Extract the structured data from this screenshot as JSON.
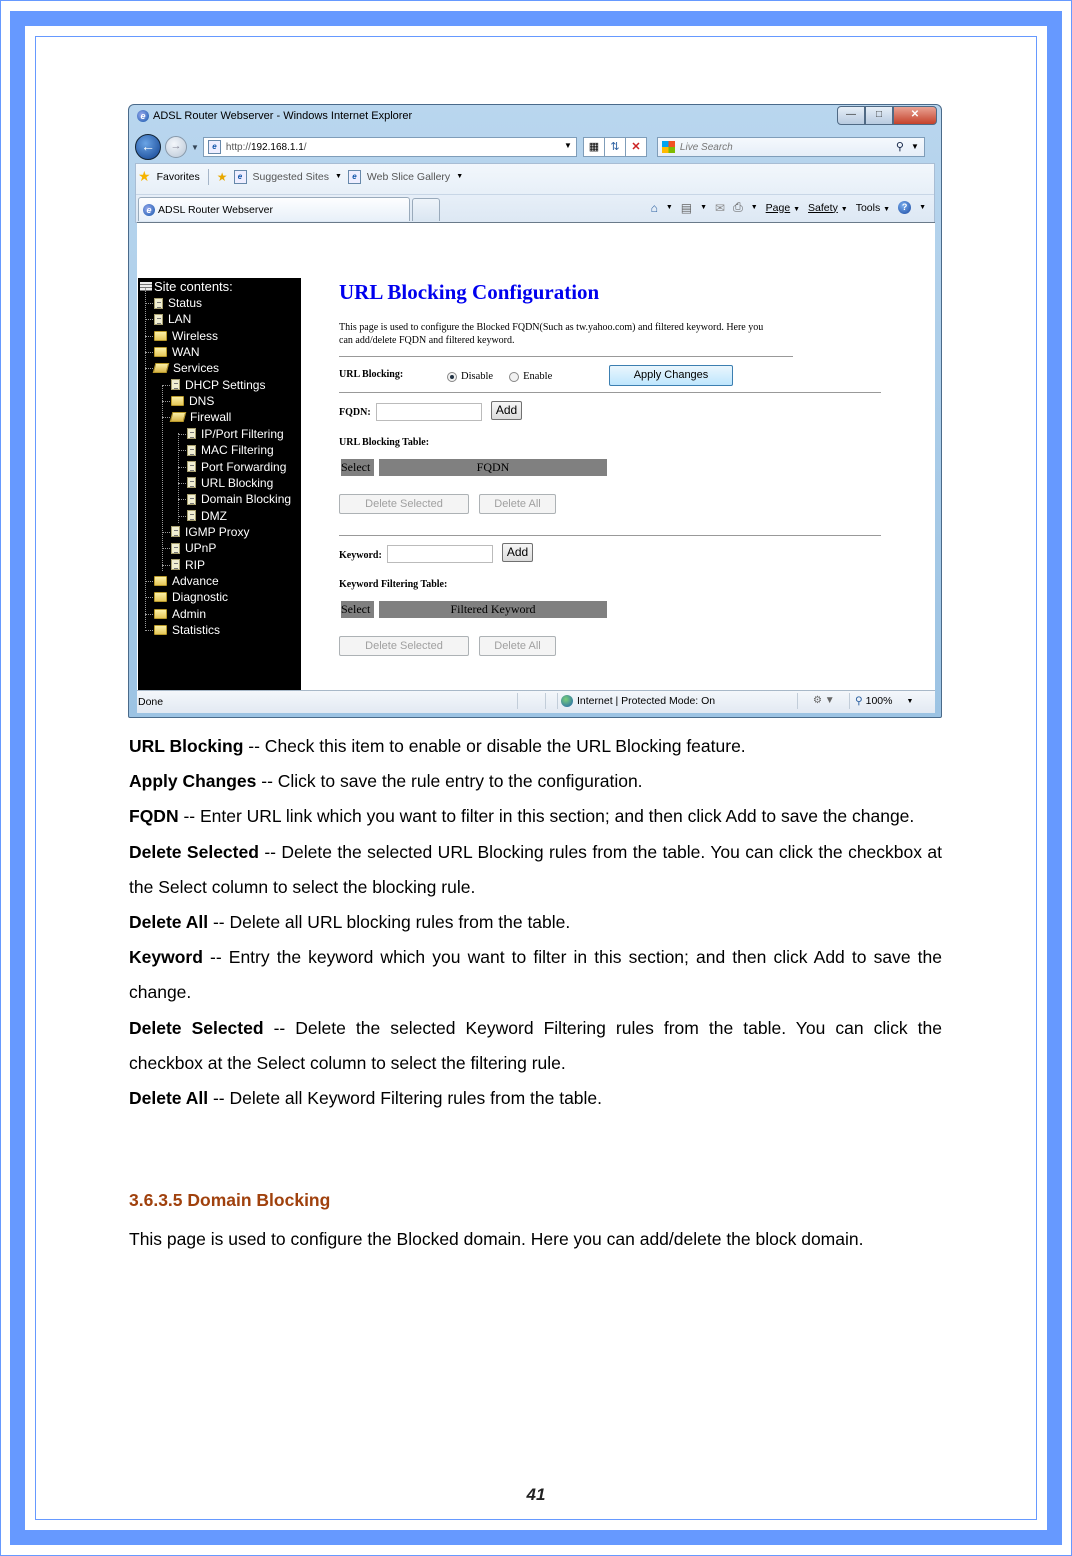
{
  "browser": {
    "window_title": "ADSL Router Webserver - Windows Internet Explorer",
    "address": {
      "scheme": "http://",
      "host": "192.168.1.1",
      "path": "/"
    },
    "search_placeholder": "Live Search",
    "favorites_label": "Favorites",
    "suggested_sites_label": "Suggested Sites",
    "web_slice_gallery_label": "Web Slice Gallery",
    "tab_title": "ADSL Router Webserver",
    "command_bar": {
      "page": "Page",
      "safety": "Safety",
      "tools": "Tools"
    },
    "status": {
      "left": "Done",
      "zone": "Internet | Protected Mode: On",
      "zoom": "100%"
    }
  },
  "sidebar": {
    "title": "Site contents:",
    "items": [
      {
        "label": "Status",
        "icon": "document",
        "level": 1
      },
      {
        "label": "LAN",
        "icon": "document",
        "level": 1
      },
      {
        "label": "Wireless",
        "icon": "folder",
        "level": 1
      },
      {
        "label": "WAN",
        "icon": "folder",
        "level": 1
      },
      {
        "label": "Services",
        "icon": "folder-open",
        "level": 1
      },
      {
        "label": "DHCP Settings",
        "icon": "document",
        "level": 2
      },
      {
        "label": "DNS",
        "icon": "folder",
        "level": 2
      },
      {
        "label": "Firewall",
        "icon": "folder-open",
        "level": 2
      },
      {
        "label": "IP/Port Filtering",
        "icon": "document",
        "level": 3
      },
      {
        "label": "MAC Filtering",
        "icon": "document",
        "level": 3
      },
      {
        "label": "Port Forwarding",
        "icon": "document",
        "level": 3
      },
      {
        "label": "URL Blocking",
        "icon": "document",
        "level": 3
      },
      {
        "label": "Domain Blocking",
        "icon": "document",
        "level": 3
      },
      {
        "label": "DMZ",
        "icon": "document",
        "level": 3
      },
      {
        "label": "IGMP Proxy",
        "icon": "document",
        "level": 2
      },
      {
        "label": "UPnP",
        "icon": "document",
        "level": 2
      },
      {
        "label": "RIP",
        "icon": "document",
        "level": 2
      },
      {
        "label": "Advance",
        "icon": "folder",
        "level": 1
      },
      {
        "label": "Diagnostic",
        "icon": "folder",
        "level": 1
      },
      {
        "label": "Admin",
        "icon": "folder",
        "level": 1
      },
      {
        "label": "Statistics",
        "icon": "folder",
        "level": 1
      }
    ]
  },
  "config": {
    "title": "URL Blocking Configuration",
    "description": "This page is used to configure the Blocked FQDN(Such as tw.yahoo.com) and filtered keyword. Here you can add/delete FQDN and filtered keyword.",
    "url_blocking_label": "URL Blocking:",
    "radio_disable": "Disable",
    "radio_enable": "Enable",
    "selected_mode": "Disable",
    "apply_label": "Apply Changes",
    "fqdn_label": "FQDN:",
    "fqdn_value": "",
    "add_label": "Add",
    "url_table_label": "URL Blocking Table:",
    "url_table_headers": [
      "Select",
      "FQDN"
    ],
    "delete_selected_label": "Delete Selected",
    "delete_all_label": "Delete All",
    "keyword_label": "Keyword:",
    "keyword_value": "",
    "keyword_table_label": "Keyword Filtering Table:",
    "keyword_table_headers": [
      "Select",
      "Filtered Keyword"
    ]
  },
  "doc": {
    "items": [
      {
        "term": "URL Blocking",
        "text": " -- Check this item to enable or disable the URL Blocking feature."
      },
      {
        "term": "Apply Changes",
        "text": " -- Click to save the rule entry to the configuration."
      },
      {
        "term": "FQDN",
        "text": " -- Enter URL link which you want to filter in this section; and then click Add to save the change."
      },
      {
        "term": "Delete Selected",
        "text": " -- Delete the selected URL Blocking rules from the table. You can click the checkbox at the Select column to select the blocking rule."
      },
      {
        "term": "Delete All",
        "text": " -- Delete all URL blocking rules from the table."
      },
      {
        "term": "Keyword",
        "text": " -- Entry the keyword which you want to filter in this section; and then click Add to save the change."
      },
      {
        "term": "Delete Selected",
        "text": " -- Delete the selected Keyword Filtering rules from the table. You can click the checkbox at the Select column to select the filtering rule."
      },
      {
        "term": "Delete All",
        "text": " -- Delete all Keyword Filtering rules from the table."
      }
    ],
    "section_heading": "3.6.3.5 Domain Blocking",
    "section_text": "This page is used to configure the Blocked domain. Here you can add/delete the block domain.",
    "page_number": "41"
  },
  "colors": {
    "page_border": "#6699ff",
    "title_blue": "#0000ee",
    "section_heading": "#a0410d",
    "table_header": "#808080"
  }
}
